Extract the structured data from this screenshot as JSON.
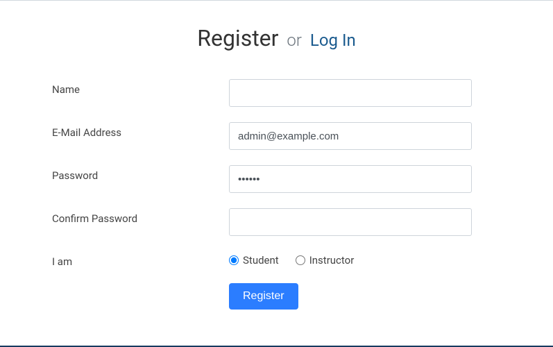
{
  "heading": {
    "main": "Register",
    "or": "or",
    "login_link": "Log In"
  },
  "form": {
    "name": {
      "label": "Name",
      "value": ""
    },
    "email": {
      "label": "E-Mail Address",
      "value": "admin@example.com"
    },
    "password": {
      "label": "Password",
      "value": "••••••"
    },
    "confirm_password": {
      "label": "Confirm Password",
      "value": ""
    },
    "role": {
      "label": "I am",
      "options": {
        "student": "Student",
        "instructor": "Instructor"
      },
      "selected": "student"
    },
    "submit": "Register"
  }
}
